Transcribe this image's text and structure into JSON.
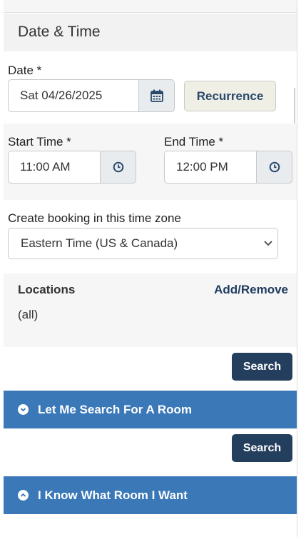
{
  "section": {
    "title": "Date & Time"
  },
  "date": {
    "label": "Date *",
    "value": "Sat 04/26/2025",
    "calendar_icon": "calendar-icon"
  },
  "recurrence": {
    "label": "Recurrence"
  },
  "start_time": {
    "label": "Start Time *",
    "value": "11:00 AM",
    "icon": "clock-icon"
  },
  "end_time": {
    "label": "End Time *",
    "value": "12:00 PM",
    "icon": "clock-icon"
  },
  "timezone": {
    "label": "Create booking in this time zone",
    "selected": "Eastern Time (US & Canada)"
  },
  "locations": {
    "label": "Locations",
    "link": "Add/Remove",
    "value": "(all)"
  },
  "search_buttons": [
    "Search",
    "Search"
  ],
  "accordions": [
    {
      "label": "Let Me Search For A Room",
      "state": "collapsed"
    },
    {
      "label": "I Know What Room I Want",
      "state": "expanded"
    }
  ],
  "colors": {
    "accent_blue": "#3a78b8",
    "navy": "#243f5e",
    "link": "#1e3a5f",
    "addon_bg": "#e9ecef"
  }
}
